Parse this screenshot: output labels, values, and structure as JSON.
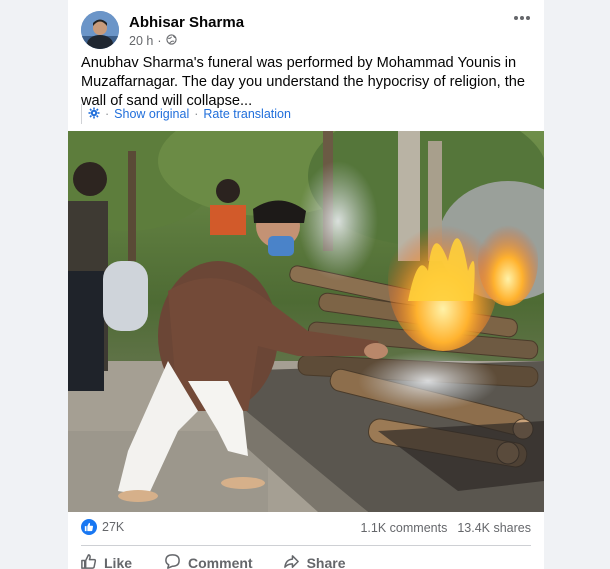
{
  "post": {
    "author": "Abhisar Sharma",
    "time": "20 h",
    "time_separator": "·",
    "text": "Anubhav Sharma's funeral was performed by Mohammad Younis in Muzaffarnagar. The day you understand the hypocrisy of religion, the wall of sand will collapse...",
    "privacy_icon": "globe-icon"
  },
  "translation": {
    "show_original": "Show original",
    "separator": "·",
    "rate_translation": "Rate translation",
    "icon": "gear-icon"
  },
  "stats": {
    "reaction_count": "27K",
    "comments": "1.1K comments",
    "shares": "13.4K shares"
  },
  "actions": {
    "like": "Like",
    "comment": "Comment",
    "share": "Share"
  },
  "colors": {
    "link": "#216fdb",
    "like_blue": "#1877f2",
    "muted": "#65676b"
  }
}
